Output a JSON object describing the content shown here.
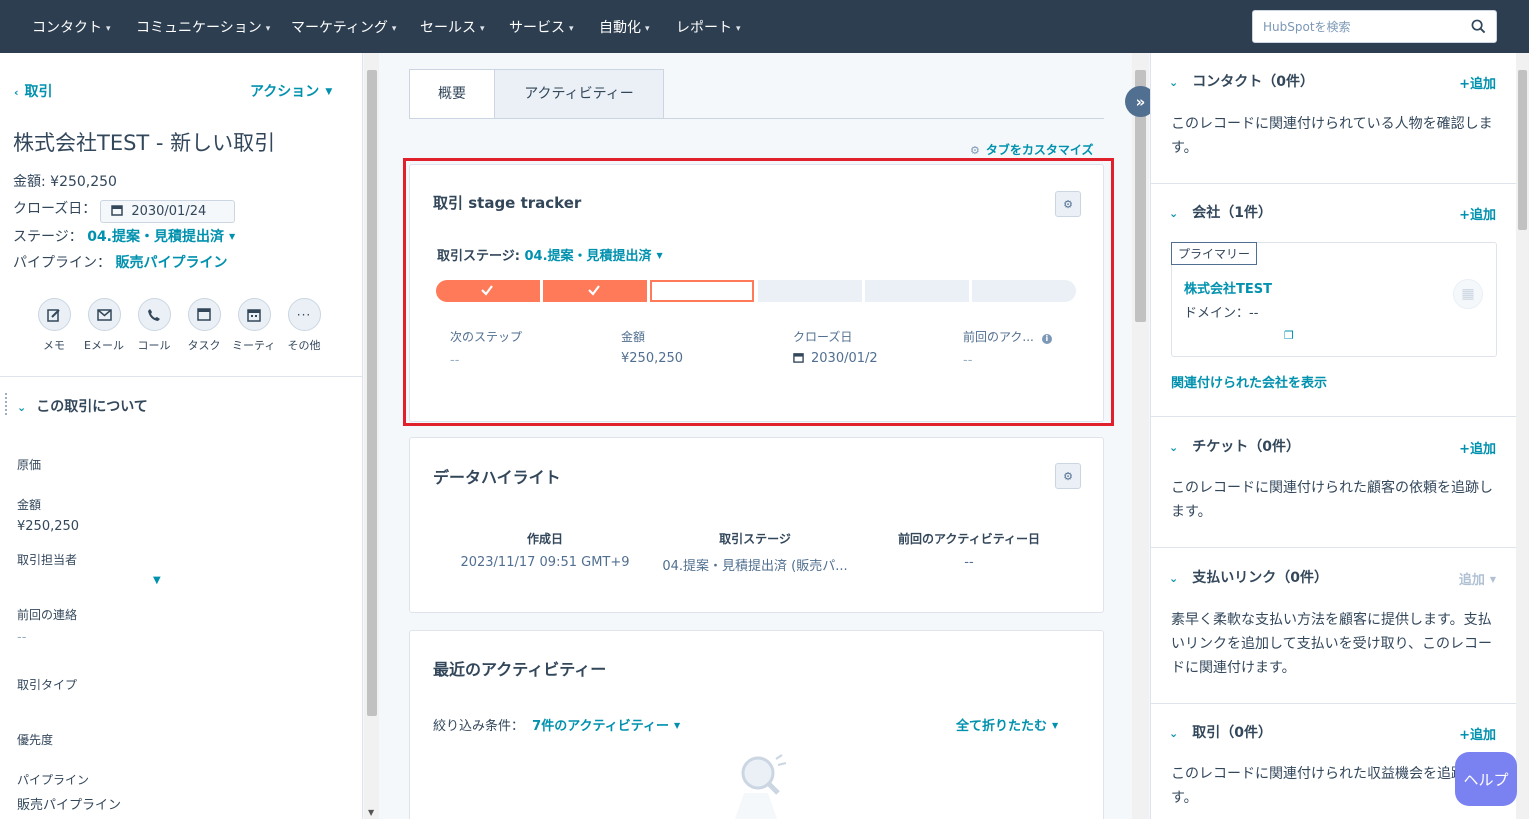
{
  "topnav": {
    "items": [
      {
        "label": "コンタクト"
      },
      {
        "label": "コミュニケーション"
      },
      {
        "label": "マーケティング"
      },
      {
        "label": "セールス"
      },
      {
        "label": "サービス"
      },
      {
        "label": "自動化"
      },
      {
        "label": "レポート"
      }
    ],
    "search_placeholder": "HubSpotを検索"
  },
  "left": {
    "back_label": "取引",
    "actions_label": "アクション",
    "deal_title": "株式会社TEST - 新しい取引",
    "amount_line": "金額: ¥250,250",
    "close_date_label": "クローズ日：",
    "close_date_value": "2030/01/24",
    "stage_label": "ステージ：",
    "stage_value": "04.提案・見積提出済",
    "pipeline_label": "パイプライン：",
    "pipeline_value": "販売パイプライン",
    "activity_buttons": [
      {
        "label": "メモ",
        "icon": "edit-icon"
      },
      {
        "label": "Eメール",
        "icon": "email-icon"
      },
      {
        "label": "コール",
        "icon": "phone-icon"
      },
      {
        "label": "タスク",
        "icon": "task-icon"
      },
      {
        "label": "ミーティング",
        "icon": "calendar-icon"
      },
      {
        "label": "その他",
        "icon": "more-icon"
      }
    ],
    "about_section_title": "この取引について",
    "fields": [
      {
        "label": "原価",
        "value": ""
      },
      {
        "label": "金額",
        "value": "¥250,250"
      },
      {
        "label": "取引担当者",
        "value": ""
      },
      {
        "label": "前回の連絡",
        "value": "--"
      },
      {
        "label": "取引タイプ",
        "value": ""
      },
      {
        "label": "優先度",
        "value": ""
      },
      {
        "label": "パイプライン",
        "value": "販売パイプライン"
      }
    ]
  },
  "center": {
    "tabs": [
      {
        "label": "概要"
      },
      {
        "label": "アクティビティー"
      }
    ],
    "customize_label": "タブをカスタマイズ",
    "stage_tracker": {
      "title": "取引 stage tracker",
      "stage_label": "取引ステージ:",
      "stage_value": "04.提案・見積提出済",
      "segments_total": 6,
      "segments_completed": 2,
      "current_segment": 3,
      "stats": [
        {
          "label": "次のステップ",
          "value": "--"
        },
        {
          "label": "金額",
          "value": "¥250,250"
        },
        {
          "label": "クローズ日",
          "value": "2030/01/2"
        },
        {
          "label": "前回のアク...",
          "value": "--"
        }
      ]
    },
    "data_highlights": {
      "title": "データハイライト",
      "columns": [
        {
          "label": "作成日",
          "value": "2023/11/17 09:51 GMT+9"
        },
        {
          "label": "取引ステージ",
          "value": "04.提案・見積提出済 (販売パ..."
        },
        {
          "label": "前回のアクティビティー日",
          "value": "--"
        }
      ]
    },
    "recent_activity": {
      "title": "最近のアクティビティー",
      "filter_label": "絞り込み条件：",
      "filter_value": "7件のアクティビティー",
      "collapse_all": "全て折りたたむ"
    }
  },
  "right": {
    "sections": [
      {
        "title": "コンタクト（0件）",
        "add": "+追加",
        "text": "このレコードに関連付けられている人物を確認します。"
      },
      {
        "title": "会社（1件）",
        "add": "+追加"
      },
      {
        "title": "チケット（0件）",
        "add": "+追加",
        "text": "このレコードに関連付けられた顧客の依頼を追跡します。"
      },
      {
        "title": "支払いリンク（0件）",
        "add": "追加",
        "text": "素早く柔軟な支払い方法を顧客に提供します。支払いリンクを追加して支払いを受け取り、このレコードに関連付けます。"
      },
      {
        "title": "取引（0件）",
        "add": "+追加",
        "text": "このレコードに関連付けられた収益機会を追跡します。"
      }
    ],
    "company": {
      "primary_tag": "プライマリー",
      "name": "株式会社TEST",
      "domain": "ドメイン：--",
      "view_link": "関連付けられた会社を表示"
    },
    "help_label": "ヘルプ"
  },
  "colors": {
    "nav_bg": "#2d3e50",
    "accent": "#0091ae",
    "tracker_done": "#ff7a59",
    "highlight_box": "#e0202a",
    "help_button": "#7a82f2"
  }
}
